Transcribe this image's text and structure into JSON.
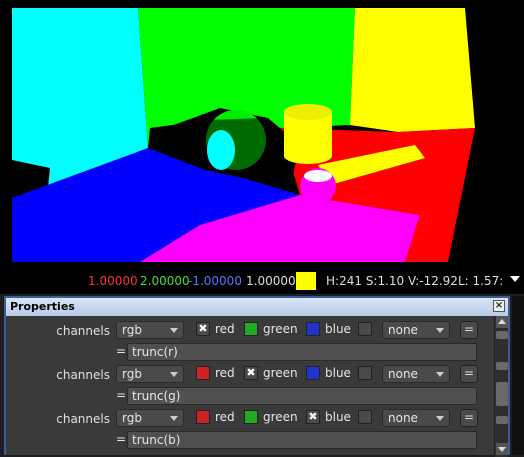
{
  "status": {
    "r": "1.00000",
    "g": "2.00000",
    "b": "-1.00000",
    "a": "1.00000",
    "hsv": "H:241 S:1.10 V:-12.92",
    "l": "L: 1.57:",
    "color_r": "#ff3333",
    "color_g": "#44dd44",
    "color_b": "#5577ff",
    "swatch": "#ffff00"
  },
  "properties": {
    "title": "Properties",
    "close": "×",
    "rows": [
      {
        "label": "channels",
        "channel": "rgb",
        "c1": "red",
        "c2": "green",
        "c3": "blue",
        "checked": "red",
        "extra": "none",
        "eq": "=",
        "expr_eq": "=",
        "expr": "trunc(r)"
      },
      {
        "label": "channels",
        "channel": "rgb",
        "c1": "red",
        "c2": "green",
        "c3": "blue",
        "checked": "green",
        "extra": "none",
        "eq": "=",
        "expr_eq": "=",
        "expr": "trunc(g)"
      },
      {
        "label": "channels",
        "channel": "rgb",
        "c1": "red",
        "c2": "green",
        "c3": "blue",
        "checked": "blue",
        "extra": "none",
        "eq": "=",
        "expr_eq": "=",
        "expr": "trunc(b)"
      }
    ]
  }
}
